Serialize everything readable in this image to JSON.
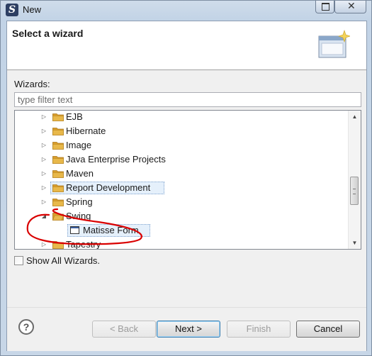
{
  "window": {
    "title": "New",
    "app_icon_letter": "S"
  },
  "header": {
    "title": "Select a wizard"
  },
  "wizards_label": "Wizards:",
  "filter": {
    "placeholder": "type filter text",
    "value": ""
  },
  "tree": {
    "items": [
      {
        "label": "EJB",
        "expanded": false,
        "icon": "folder-icon",
        "selected": false
      },
      {
        "label": "Hibernate",
        "expanded": false,
        "icon": "folder-icon",
        "selected": false
      },
      {
        "label": "Image",
        "expanded": false,
        "icon": "folder-icon",
        "selected": false
      },
      {
        "label": "Java Enterprise Projects",
        "expanded": false,
        "icon": "folder-icon",
        "selected": false
      },
      {
        "label": "Maven",
        "expanded": false,
        "icon": "folder-icon",
        "selected": false
      },
      {
        "label": "Report Development",
        "expanded": false,
        "icon": "folder-icon",
        "selected": true
      },
      {
        "label": "Spring",
        "expanded": false,
        "icon": "folder-icon",
        "selected": false
      },
      {
        "label": "Swing",
        "expanded": true,
        "icon": "folder-icon",
        "selected": false
      },
      {
        "label": "Matisse Form",
        "child": true,
        "icon": "form-icon",
        "selected": true
      },
      {
        "label": "Tapestry",
        "expanded": false,
        "icon": "folder-icon",
        "selected": false
      }
    ]
  },
  "show_all": {
    "label": "Show All Wizards.",
    "checked": false
  },
  "buttons": {
    "help": "?",
    "back": "< Back",
    "next": "Next >",
    "finish": "Finish",
    "cancel": "Cancel"
  },
  "colors": {
    "annotation_red": "#d90000",
    "folder_yellow": "#e8b84a"
  }
}
